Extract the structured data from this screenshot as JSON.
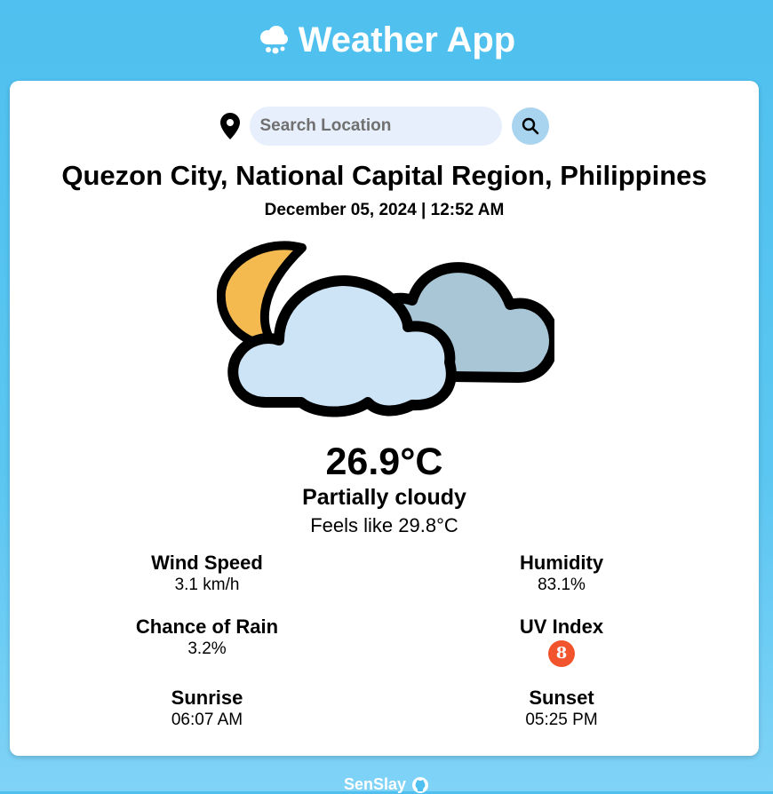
{
  "header": {
    "title": "Weather App",
    "logo_icon": "cloud-hail-icon"
  },
  "search": {
    "placeholder": "Search Location",
    "value": "",
    "location_icon": "map-pin-icon",
    "button_icon": "search-icon"
  },
  "current": {
    "location": "Quezon City, National Capital Region, Philippines",
    "datetime": "December 05, 2024 | 12:52 AM",
    "icon": "partly-cloudy-night-icon",
    "temperature": "26.9°C",
    "condition": "Partially cloudy",
    "feels_like": "Feels like 29.8°C"
  },
  "stats": {
    "wind": {
      "label": "Wind Speed",
      "value": "3.1 km/h"
    },
    "humidity": {
      "label": "Humidity",
      "value": "83.1%"
    },
    "rain": {
      "label": "Chance of Rain",
      "value": "3.2%"
    },
    "uv": {
      "label": "UV Index",
      "value": "8",
      "color": "#f2542d"
    },
    "sunrise": {
      "label": "Sunrise",
      "value": "06:07 AM"
    },
    "sunset": {
      "label": "Sunset",
      "value": "05:25 PM"
    }
  },
  "footer": {
    "author": "SenSlay",
    "icon": "github-icon"
  },
  "colors": {
    "background": "#4fc0ef",
    "card": "#ffffff",
    "search_bg": "#e6effb",
    "search_button": "#a8d4f0"
  }
}
